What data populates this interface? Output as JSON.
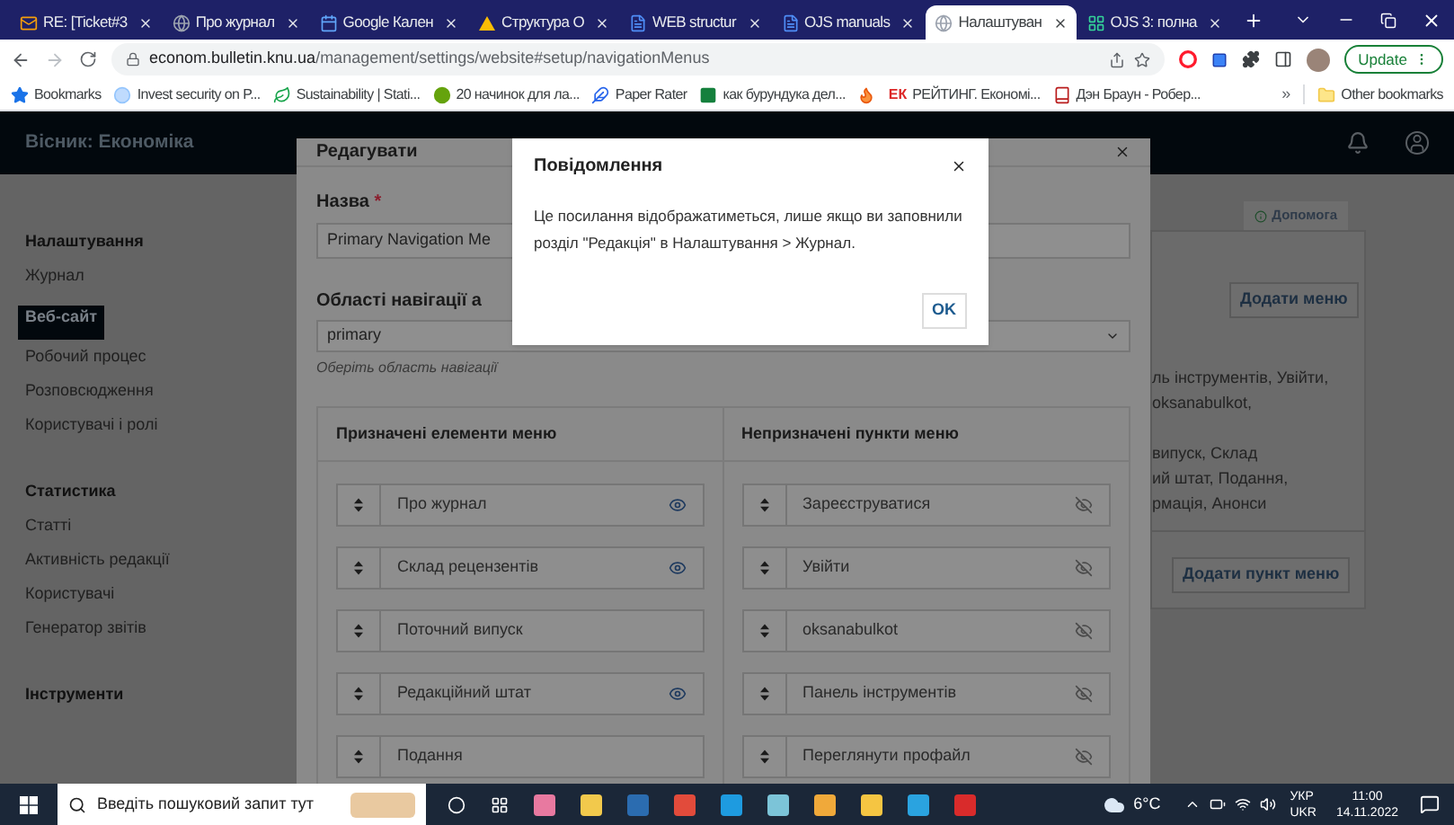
{
  "browser": {
    "tabs": [
      {
        "title": "RE: [Ticket#3",
        "kind": "mail",
        "selected": false
      },
      {
        "title": "Про журнал",
        "kind": "globe",
        "selected": false
      },
      {
        "title": "Google Кален",
        "kind": "calendar",
        "selected": false
      },
      {
        "title": "Структура О",
        "kind": "drive",
        "selected": false
      },
      {
        "title": "WEB structur",
        "kind": "doc",
        "selected": false
      },
      {
        "title": "OJS manuals",
        "kind": "doc",
        "selected": false
      },
      {
        "title": "Налаштуван",
        "kind": "globe",
        "selected": true
      },
      {
        "title": "OJS 3: полна",
        "kind": "grid",
        "selected": false
      }
    ],
    "url_domain": "econom.bulletin.knu.ua",
    "url_path": "/management/settings/website#setup/navigationMenus",
    "update_button": "Update",
    "bookmarks": [
      {
        "label": "Bookmarks",
        "kind": "star"
      },
      {
        "label": "Invest security on P...",
        "kind": "circle"
      },
      {
        "label": "Sustainability | Stati...",
        "kind": "sprout"
      },
      {
        "label": "20 начинок для ла...",
        "kind": "dot"
      },
      {
        "label": "Paper Rater",
        "kind": "feather"
      },
      {
        "label": "как бурундука дел...",
        "kind": "square"
      },
      {
        "kind": "flame"
      },
      {
        "label": "РЕЙТИНГ. Економі...",
        "kind": "badge",
        "badge": "ЕК"
      },
      {
        "label": "Дэн Браун - Робер...",
        "kind": "book"
      }
    ],
    "overflow": "»",
    "other_bookmarks": "Other bookmarks"
  },
  "site": {
    "title": "Вісник: Економіка"
  },
  "sidebar": {
    "sections": [
      {
        "title": "Налаштування",
        "items": [
          {
            "label": "Журнал",
            "selected": false
          },
          {
            "label": "Веб-сайт",
            "selected": true
          },
          {
            "label": "Робочий процес",
            "selected": false
          },
          {
            "label": "Розповсюдження",
            "selected": false
          },
          {
            "label": "Користувачі і ролі",
            "selected": false
          }
        ]
      },
      {
        "title": "Статистика",
        "items": [
          {
            "label": "Статті",
            "selected": false
          },
          {
            "label": "Активність редакції",
            "selected": false
          },
          {
            "label": "Користувачі",
            "selected": false
          },
          {
            "label": "Генератор звітів",
            "selected": false
          }
        ]
      },
      {
        "title": "Інструменти"
      }
    ]
  },
  "background_panel": {
    "help_tab": "Допомога",
    "add_menu_button": "Додати меню",
    "summary_1": [
      "ль інструментів, Увійти,",
      "oksanabulkot,"
    ],
    "summary_2": [
      "випуск, Склад",
      "ий штат, Подання,",
      "рмація, Анонси"
    ],
    "add_item_button": "Додати пункт меню"
  },
  "edit_modal": {
    "title": "Редагувати",
    "name_label": "Назва",
    "required_mark": "*",
    "name_value": "Primary Navigation Me",
    "area_label": "Області навігації а",
    "area_value": "primary",
    "area_hint": "Оберіть область навігації",
    "assigned": {
      "heading": "Призначені елементи меню",
      "items": [
        {
          "label": "Про журнал",
          "kind": "eye"
        },
        {
          "label": "Склад рецензентів",
          "kind": "eye"
        },
        {
          "label": "Поточний випуск",
          "kind": "none"
        },
        {
          "label": "Редакційний штат",
          "kind": "eye"
        },
        {
          "label": "Подання",
          "kind": "none"
        }
      ]
    },
    "unassigned": {
      "heading": "Непризначені пункти меню",
      "items": [
        {
          "label": "Зареєструватися",
          "kind": "eye-off"
        },
        {
          "label": "Увійти",
          "kind": "eye-off"
        },
        {
          "label": "oksanabulkot",
          "kind": "eye-off"
        },
        {
          "label": "Панель інструментів",
          "kind": "eye-off"
        },
        {
          "label": "Переглянути профайл",
          "kind": "eye-off"
        }
      ]
    }
  },
  "notice_dialog": {
    "title": "Повідомлення",
    "message": "Це посилання відображатиметься, лише якщо ви заповнили розділ \"Редакція\" в Налаштування > Журнал.",
    "ok_button": "OK"
  },
  "taskbar": {
    "search_placeholder": "Введіть пошуковий запит тут",
    "weather": "6°C",
    "language": [
      "УКР",
      "UKR"
    ],
    "time": "11:00",
    "date": "14.11.2022"
  }
}
